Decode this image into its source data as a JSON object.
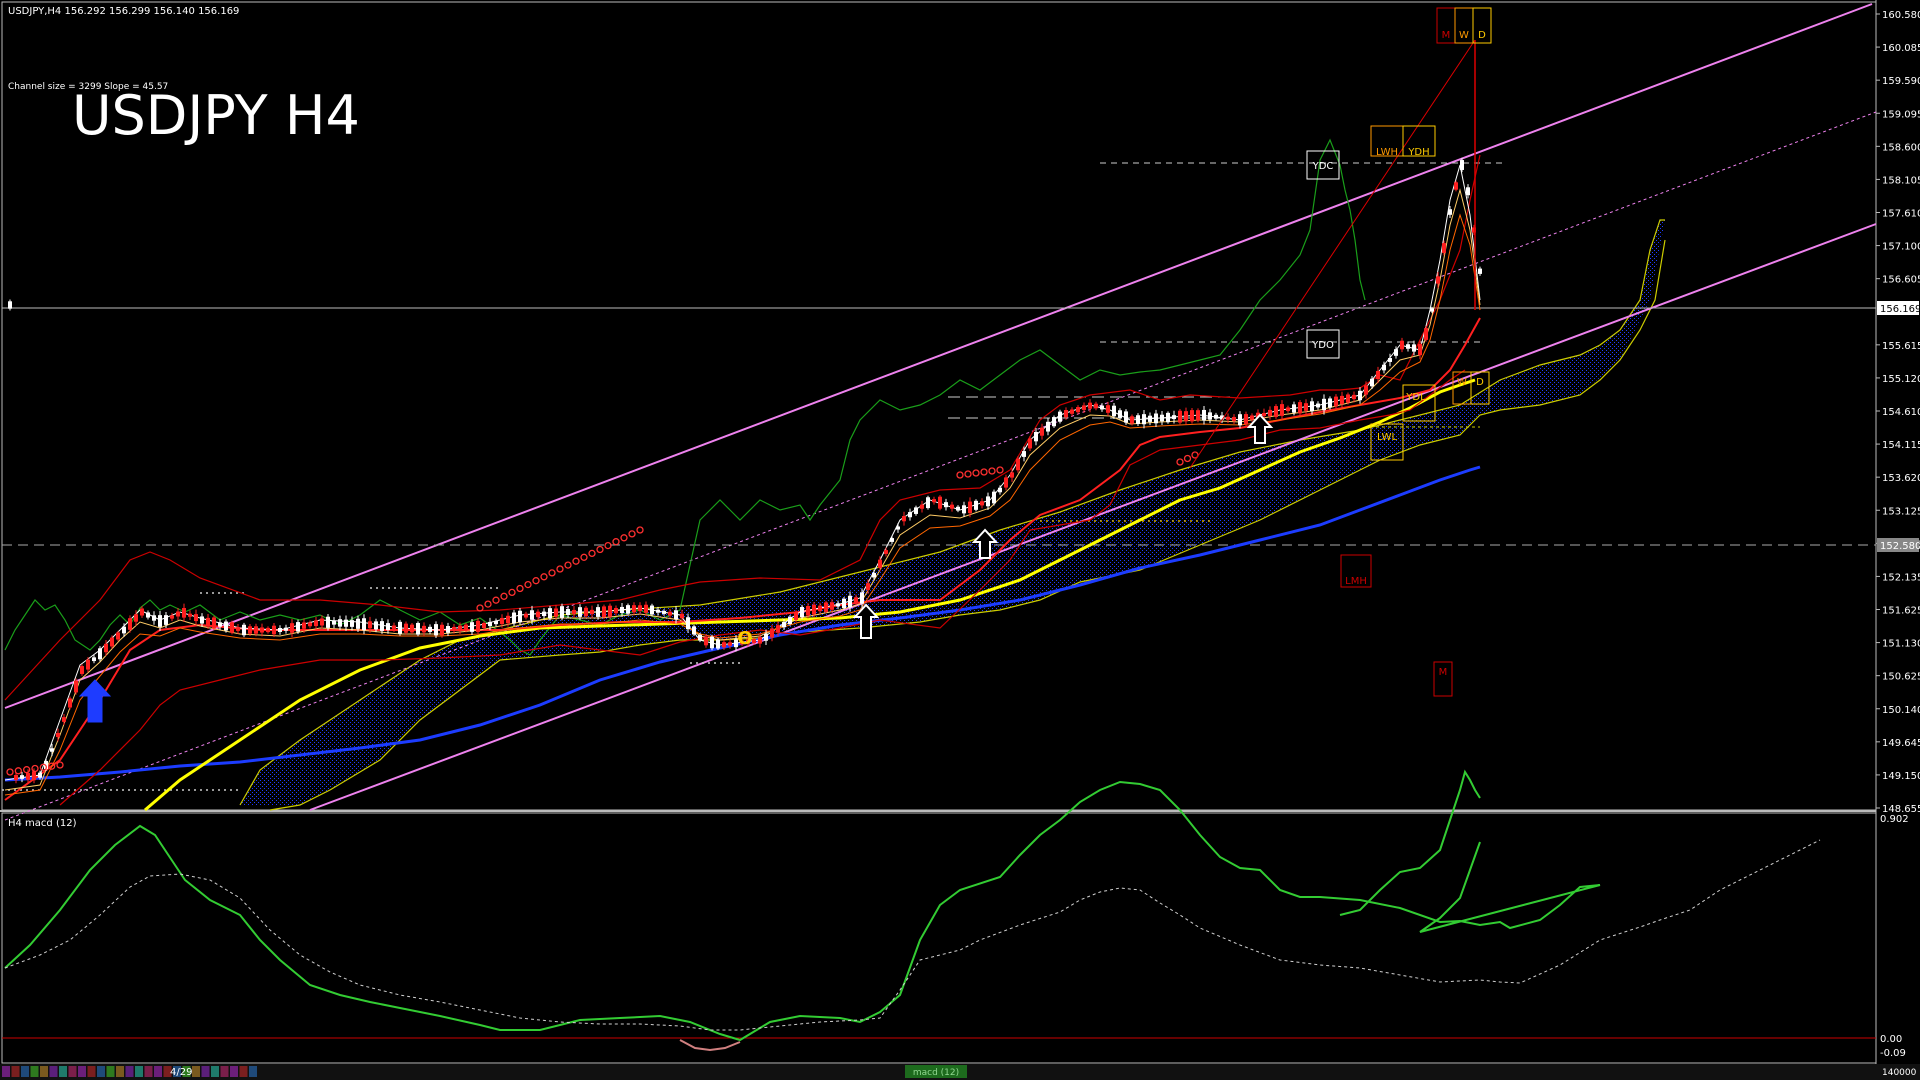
{
  "header": {
    "info": "USDJPY,H4  156.292 156.299 156.140 156.169",
    "channel": "Channel size = 3299 Slope = 45.57",
    "title": "USDJPY H4"
  },
  "price_axis": {
    "labels": [
      "160.580",
      "160.085",
      "159.590",
      "159.095",
      "158.600",
      "158.105",
      "157.610",
      "157.100",
      "156.605",
      "156.169",
      "155.615",
      "155.120",
      "154.610",
      "154.115",
      "153.620",
      "153.125",
      "152.580",
      "152.135",
      "151.625",
      "151.130",
      "150.625",
      "150.140",
      "149.645",
      "149.150",
      "148.655"
    ],
    "current": "156.169",
    "dashed_level": "152.580"
  },
  "macd_axis": {
    "top": "0.902",
    "zero": "0.00",
    "bottom": "-0.09"
  },
  "indicator_label": "H4  macd (12)",
  "markers": {
    "ydc": "YDC",
    "ydo": "YDO",
    "ydh": "YDH",
    "lwh": "LWH",
    "lmh": "LMH",
    "ydl": "YDL",
    "lwl": "LWL",
    "m": "M",
    "w": "W",
    "d": "D",
    "o": "O"
  },
  "bottom_bar": {
    "date": "4/29",
    "tab": "macd (12)",
    "right": "140000"
  },
  "colors": {
    "channel": "#ee82ee",
    "ema_yellow": "#ffff00",
    "ema_blue": "#1c3cff",
    "macd": "#33cc33",
    "signal": "#d0d0d0",
    "bollinger": "#cc0000",
    "cloud": "#1e3cff",
    "cloud_edge": "#cccc00",
    "lagging": "#1a9e1a"
  },
  "chart_data": {
    "type": "line",
    "x": [
      "4/29"
    ],
    "price_range": [
      148.655,
      160.58
    ],
    "last_price": 156.169,
    "series": [],
    "macd_range": [
      -0.09,
      0.902
    ]
  }
}
